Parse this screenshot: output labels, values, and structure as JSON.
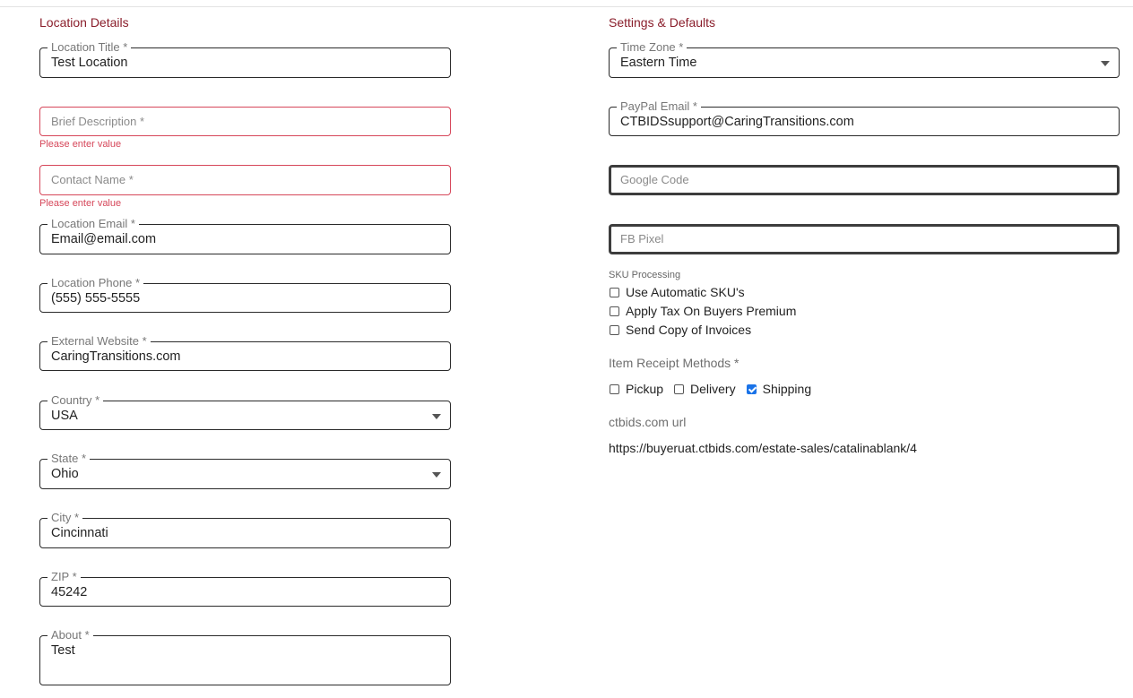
{
  "left": {
    "section_title": "Location Details",
    "location_title": {
      "label": "Location Title *",
      "value": "Test Location"
    },
    "brief_description": {
      "placeholder": "Brief Description *",
      "error": "Please enter value"
    },
    "contact_name": {
      "placeholder": "Contact Name *",
      "error": "Please enter value"
    },
    "location_email": {
      "label": "Location Email *",
      "value": "Email@email.com"
    },
    "location_phone": {
      "label": "Location Phone *",
      "value": "(555) 555-5555"
    },
    "external_website": {
      "label": "External Website *",
      "value": "CaringTransitions.com"
    },
    "country": {
      "label": "Country *",
      "value": "USA"
    },
    "state": {
      "label": "State *",
      "value": "Ohio"
    },
    "city": {
      "label": "City *",
      "value": "Cincinnati"
    },
    "zip": {
      "label": "ZIP *",
      "value": "45242"
    },
    "about": {
      "label": "About *",
      "value": "Test"
    }
  },
  "right": {
    "section_title": "Settings & Defaults",
    "time_zone": {
      "label": "Time Zone *",
      "value": "Eastern Time"
    },
    "paypal_email": {
      "label": "PayPal Email *",
      "value": "CTBIDSsupport@CaringTransitions.com"
    },
    "google_code": {
      "placeholder": "Google Code"
    },
    "fb_pixel": {
      "placeholder": "FB Pixel"
    },
    "sku_processing": {
      "label": "SKU Processing",
      "options": [
        {
          "label": "Use Automatic SKU's",
          "checked": false
        },
        {
          "label": "Apply Tax On Buyers Premium",
          "checked": false
        },
        {
          "label": "Send Copy of Invoices",
          "checked": false
        }
      ]
    },
    "receipt_methods": {
      "label": "Item Receipt Methods *",
      "options": [
        {
          "label": "Pickup",
          "checked": false
        },
        {
          "label": "Delivery",
          "checked": false
        },
        {
          "label": "Shipping",
          "checked": true
        }
      ]
    },
    "ctbids_url": {
      "label": "ctbids.com url",
      "value": "https://buyeruat.ctbids.com/estate-sales/catalinablank/4"
    }
  },
  "colors": {
    "accent": "#8a1e2b",
    "error": "#d6475a",
    "checkbox": "#1a73e8"
  }
}
